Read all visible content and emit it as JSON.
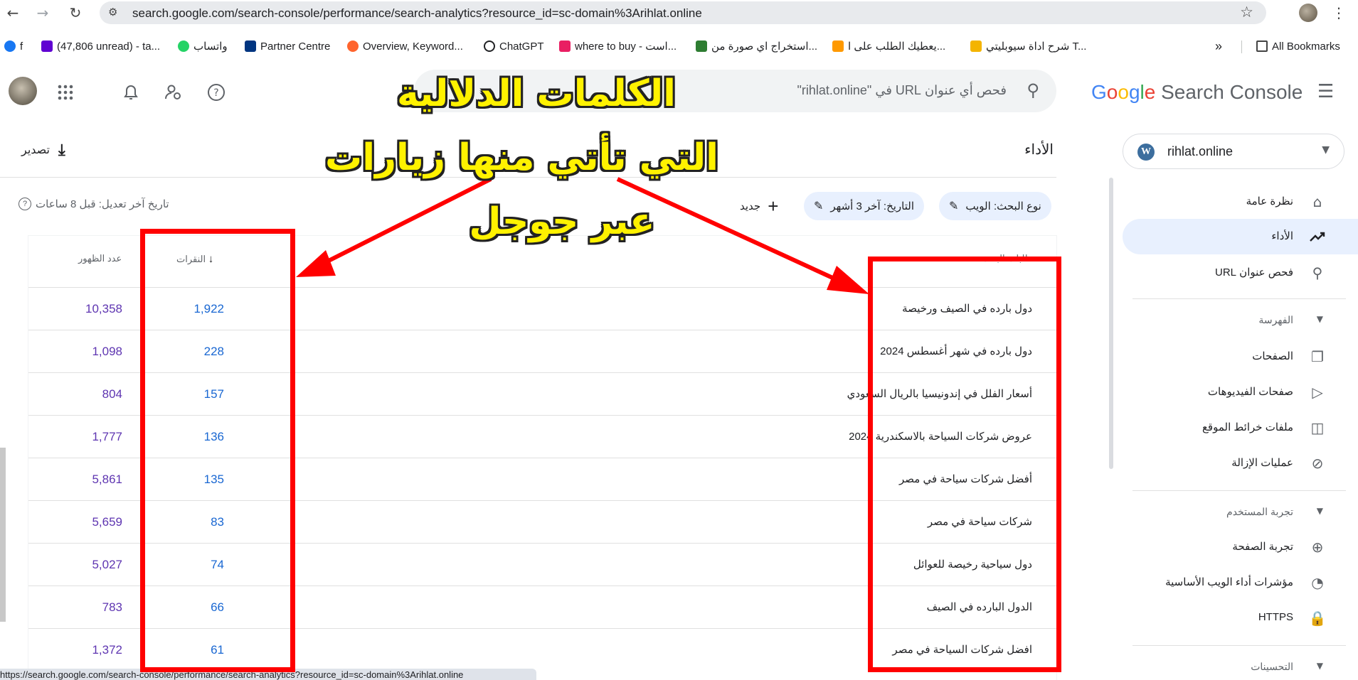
{
  "browser": {
    "url": "search.google.com/search-console/performance/search-analytics?resource_id=sc-domain%3Arihlat.online",
    "status_url": "https://search.google.com/search-console/performance/search-analytics?resource_id=sc-domain%3Arihlat.online",
    "bookmarks": [
      {
        "label": "f",
        "color": "#1877f2"
      },
      {
        "label": "(47,806 unread) - ta...",
        "color": "#6001d2"
      },
      {
        "label": "واتساب",
        "color": "#25d366"
      },
      {
        "label": "Partner Centre",
        "color": "#003580"
      },
      {
        "label": "Overview, Keyword...",
        "color": "#ff642d"
      },
      {
        "label": "ChatGPT",
        "color": "#202124"
      },
      {
        "label": "where to buy - است...",
        "color": "#e91e63"
      },
      {
        "label": "استخراج اي صورة من...",
        "color": "#2e7d32"
      },
      {
        "label": "يعطيك الطلب على ا...",
        "color": "#ff9900"
      },
      {
        "label": "شرح اداة سيوبليتي T...",
        "color": "#f4b400"
      }
    ],
    "all_bookmarks": "All Bookmarks",
    "overflow": "»"
  },
  "header": {
    "logo_google": [
      "G",
      "o",
      "o",
      "g",
      "l",
      "e"
    ],
    "logo_product": "Search Console",
    "search_placeholder": "فحص أي عنوان URL في \"rihlat.online\""
  },
  "sidebar": {
    "property": "rihlat.online",
    "items": [
      {
        "label": "نظرة عامة",
        "icon": "home-icon"
      },
      {
        "label": "الأداء",
        "icon": "trending-up-icon",
        "active": true
      },
      {
        "label": "فحص عنوان URL",
        "icon": "search-icon"
      }
    ],
    "indexing": {
      "title": "الفهرسة",
      "items": [
        {
          "label": "الصفحات",
          "icon": "pages-icon"
        },
        {
          "label": "صفحات الفيديوهات",
          "icon": "video-pages-icon"
        },
        {
          "label": "ملفات خرائط الموقع",
          "icon": "sitemap-icon"
        },
        {
          "label": "عمليات الإزالة",
          "icon": "removals-icon"
        }
      ]
    },
    "experience": {
      "title": "تجربة المستخدم",
      "items": [
        {
          "label": "تجربة الصفحة",
          "icon": "page-experience-icon"
        },
        {
          "label": "مؤشرات أداء الويب الأساسية",
          "icon": "gauge-icon"
        },
        {
          "label": "HTTPS",
          "icon": "lock-icon"
        }
      ]
    },
    "enhancements_title": "التحسينات"
  },
  "main": {
    "title": "الأداء",
    "export": "تصدير",
    "filters": {
      "search_type": "نوع البحث: الويب",
      "date": "التاريخ: آخر 3 أشهر",
      "new": "جديد"
    },
    "last_updated": "تاريخ آخر تعديل: قبل 8 ساعات",
    "table": {
      "col_query": "طلبات البحث",
      "col_clicks": "النقرات",
      "col_impressions": "عدد الظهور",
      "rows": [
        {
          "query": "دول بارده في الصيف ورخيصة",
          "clicks": "1,922",
          "impressions": "10,358"
        },
        {
          "query": "دول بارده في شهر أغسطس 2024",
          "clicks": "228",
          "impressions": "1,098"
        },
        {
          "query": "أسعار الفلل في إندونيسيا بالريال السعودي",
          "clicks": "157",
          "impressions": "804"
        },
        {
          "query": "عروض شركات السياحة بالاسكندرية 2024",
          "clicks": "136",
          "impressions": "1,777"
        },
        {
          "query": "أفضل شركات سياحة في مصر",
          "clicks": "135",
          "impressions": "5,861"
        },
        {
          "query": "شركات سياحة في مصر",
          "clicks": "83",
          "impressions": "5,659"
        },
        {
          "query": "دول سياحية رخيصة للعوائل",
          "clicks": "74",
          "impressions": "5,027"
        },
        {
          "query": "الدول البارده في الصيف",
          "clicks": "66",
          "impressions": "783"
        },
        {
          "query": "افضل شركات السياحة في مصر",
          "clicks": "61",
          "impressions": "1,372"
        }
      ]
    }
  },
  "annotation": {
    "line1": "الكلمات الدلالية",
    "line2": "التي تأتي منها زيارات",
    "line3": "عبر جوجل",
    "color": "#ff0000",
    "text_color": "#fff200"
  }
}
